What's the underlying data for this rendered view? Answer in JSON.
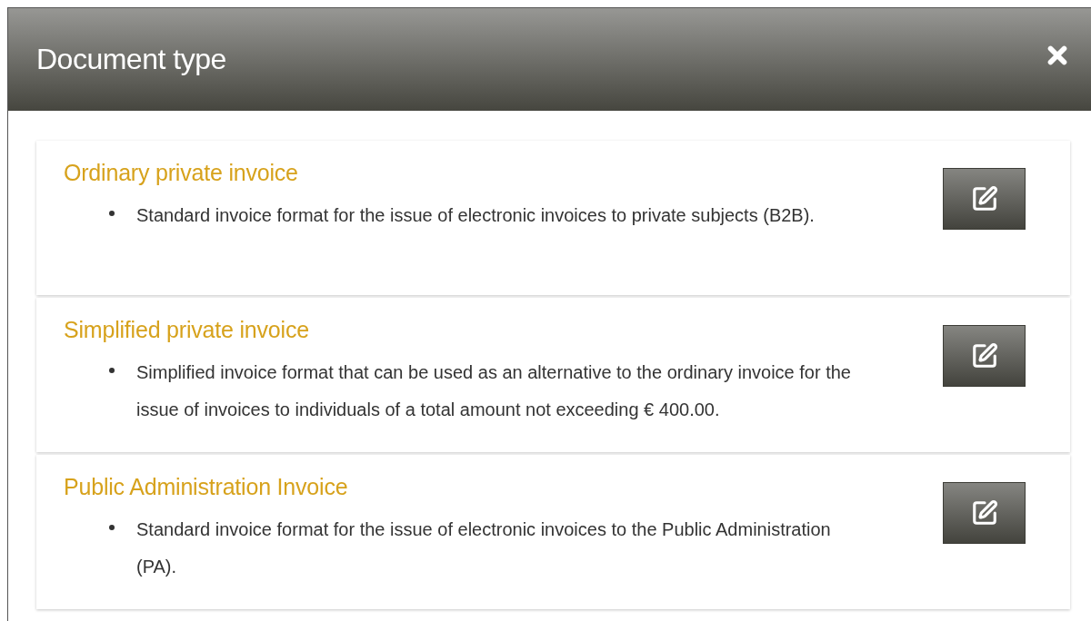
{
  "dialog": {
    "title": "Document type"
  },
  "document_types": [
    {
      "title": "Ordinary private invoice",
      "description": "Standard invoice format for the issue of electronic invoices to private subjects (B2B)."
    },
    {
      "title": "Simplified private invoice",
      "description": "Simplified invoice format that can be used as an alternative to the ordinary invoice for the issue of invoices to individuals of a total amount not exceeding € 400.00."
    },
    {
      "title": "Public Administration Invoice",
      "description": "Standard invoice format for the issue of electronic invoices to the Public Administration (PA)."
    }
  ]
}
